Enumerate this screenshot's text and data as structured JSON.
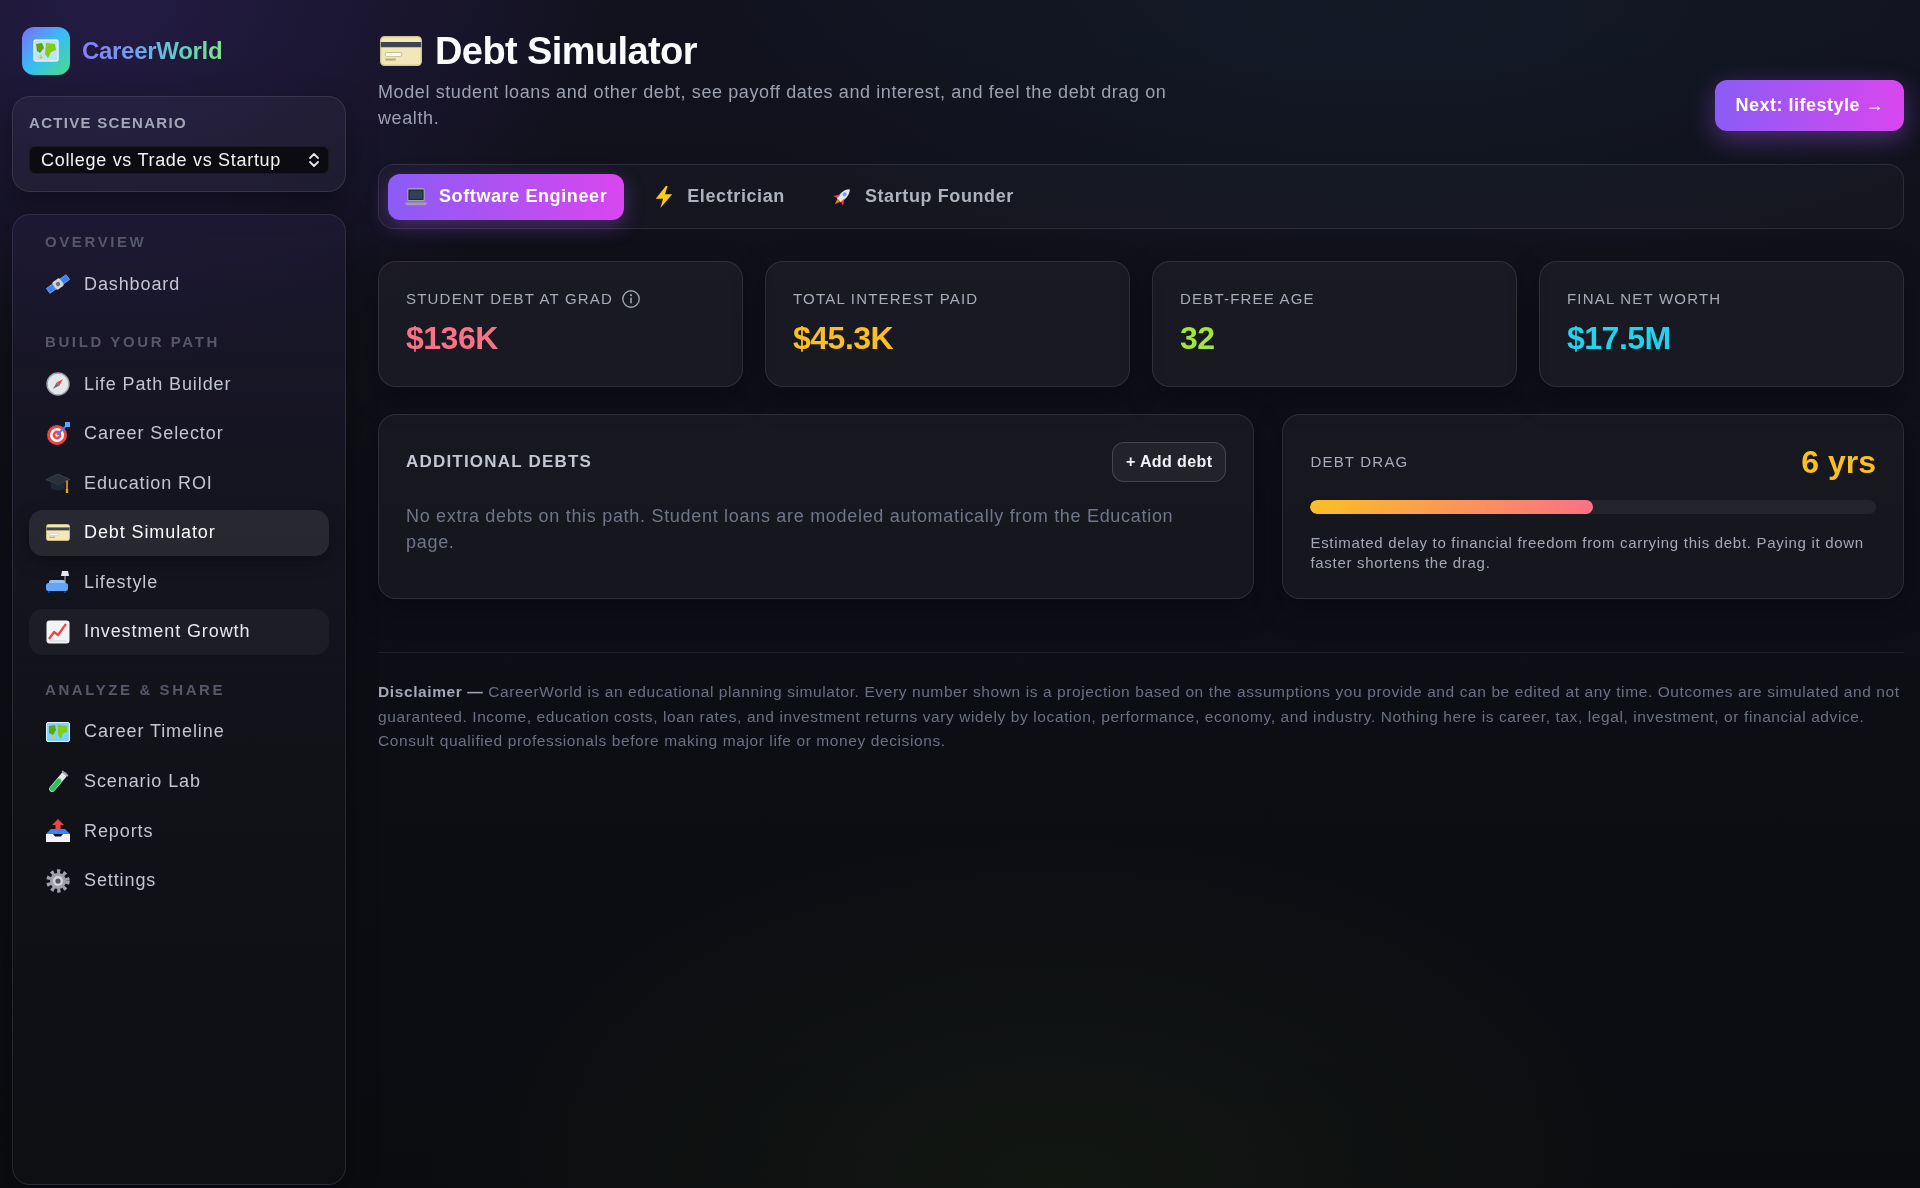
{
  "sidebar": {
    "brand": "CareerWorld",
    "scenario": {
      "label": "ACTIVE SCENARIO",
      "value": "College vs Trade vs Startup"
    },
    "sections": [
      {
        "heading": "OVERVIEW",
        "items": [
          {
            "label": "Dashboard",
            "selected": false,
            "hovered": false
          }
        ]
      },
      {
        "heading": "BUILD YOUR PATH",
        "items": [
          {
            "label": "Life Path Builder",
            "selected": false,
            "hovered": false
          },
          {
            "label": "Career Selector",
            "selected": false,
            "hovered": false
          },
          {
            "label": "Education ROI",
            "selected": false,
            "hovered": false
          },
          {
            "label": "Debt Simulator",
            "selected": true,
            "hovered": false
          },
          {
            "label": "Lifestyle",
            "selected": false,
            "hovered": false
          },
          {
            "label": "Investment Growth",
            "selected": false,
            "hovered": true
          }
        ]
      },
      {
        "heading": "ANALYZE & SHARE",
        "items": [
          {
            "label": "Career Timeline",
            "selected": false,
            "hovered": false
          },
          {
            "label": "Scenario Lab",
            "selected": false,
            "hovered": false
          },
          {
            "label": "Reports",
            "selected": false,
            "hovered": false
          },
          {
            "label": "Settings",
            "selected": false,
            "hovered": false
          }
        ]
      }
    ]
  },
  "header": {
    "title": "Debt Simulator",
    "subtitle": "Model student loans and other debt, see payoff dates and interest, and feel the debt drag on wealth.",
    "next_button": "Next: lifestyle →"
  },
  "tabs": [
    {
      "label": "Software Engineer",
      "selected": true
    },
    {
      "label": "Electrician",
      "selected": false
    },
    {
      "label": "Startup Founder",
      "selected": false
    }
  ],
  "stats": [
    {
      "label": "STUDENT DEBT AT GRAD",
      "value": "$136K",
      "color": "#fb7185",
      "info": true
    },
    {
      "label": "TOTAL INTEREST PAID",
      "value": "$45.3K",
      "color": "#fbbf24",
      "info": false
    },
    {
      "label": "DEBT-FREE AGE",
      "value": "32",
      "color": "#a3e635",
      "info": false
    },
    {
      "label": "FINAL NET WORTH",
      "value": "$17.5M",
      "color": "#22d3ee",
      "info": false
    }
  ],
  "additional_debts": {
    "title": "ADDITIONAL DEBTS",
    "add_button": "+ Add debt",
    "empty_text": "No extra debts on this path. Student loans are modeled automatically from the Education page."
  },
  "debt_drag": {
    "label": "DEBT DRAG",
    "reading": "6 yrs",
    "level": 0.5,
    "note": "Estimated delay to financial freedom from carrying this debt. Paying it down faster shortens the drag."
  },
  "disclaimer": "**Disclaimer —** CareerWorld is an educational planning simulator. Every number shown is a projection based on the assumptions you provide and can be edited at any time. Outcomes are simulated and not guaranteed. Income, education costs, loan rates, and investment returns vary widely by location, performance, economy, and industry. Nothing here is career, tax, legal, investment, or financial advice. Consult qualified professionals before making major life or money decisions."
}
